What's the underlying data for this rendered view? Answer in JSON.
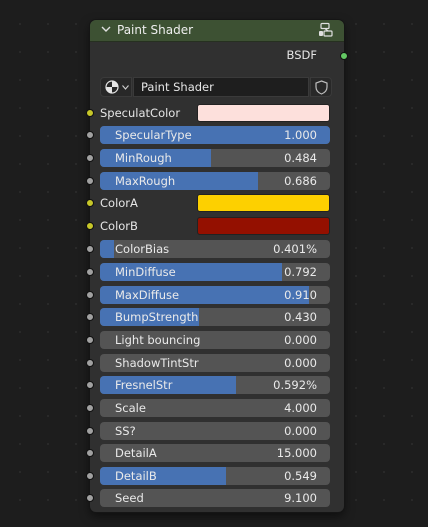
{
  "node": {
    "title": "Paint Shader",
    "output_label": "BSDF",
    "datablock_name": "Paint Shader",
    "header_color": "#3d5133",
    "picker_icon": "material-sphere-icon",
    "fake_user_icon": "shield-icon",
    "node_icon": "node-tree-icon"
  },
  "color_inputs": [
    {
      "label": "SpeculatColor",
      "color": "#fde0dc"
    },
    {
      "label": "ColorA",
      "color": "#fdd000"
    },
    {
      "label": "ColorB",
      "color": "#941000"
    }
  ],
  "value_inputs": [
    {
      "label": "SpecularType",
      "value": "1.000",
      "fill": 1.0
    },
    {
      "label": "MinRough",
      "value": "0.484",
      "fill": 0.484
    },
    {
      "label": "MaxRough",
      "value": "0.686",
      "fill": 0.686
    },
    {
      "label": "ColorBias",
      "value": "0.401%",
      "fill": 0.06
    },
    {
      "label": "MinDiffuse",
      "value": "0.792",
      "fill": 0.792
    },
    {
      "label": "MaxDiffuse",
      "value": "0.910",
      "fill": 0.91
    },
    {
      "label": "BumpStrength",
      "value": "0.430",
      "fill": 0.43
    },
    {
      "label": "Light bouncing",
      "value": "0.000",
      "fill": 0
    },
    {
      "label": "ShadowTintStr",
      "value": "0.000",
      "fill": 0
    },
    {
      "label": "FresnelStr",
      "value": "0.592%",
      "fill": 0.592
    },
    {
      "label": "Scale",
      "value": "4.000",
      "fill": 0
    },
    {
      "label": "SS?",
      "value": "0.000",
      "fill": 0
    },
    {
      "label": "DetailA",
      "value": "15.000",
      "fill": 0
    },
    {
      "label": "DetailB",
      "value": "0.549",
      "fill": 0.549
    },
    {
      "label": "Seed",
      "value": "9.100",
      "fill": 0
    }
  ],
  "colors": {
    "slider_fill": "#4772b3",
    "slider_bg": "#545454",
    "socket_float": "#a1a1a1",
    "socket_color": "#c7c729",
    "socket_shader": "#63c763"
  }
}
